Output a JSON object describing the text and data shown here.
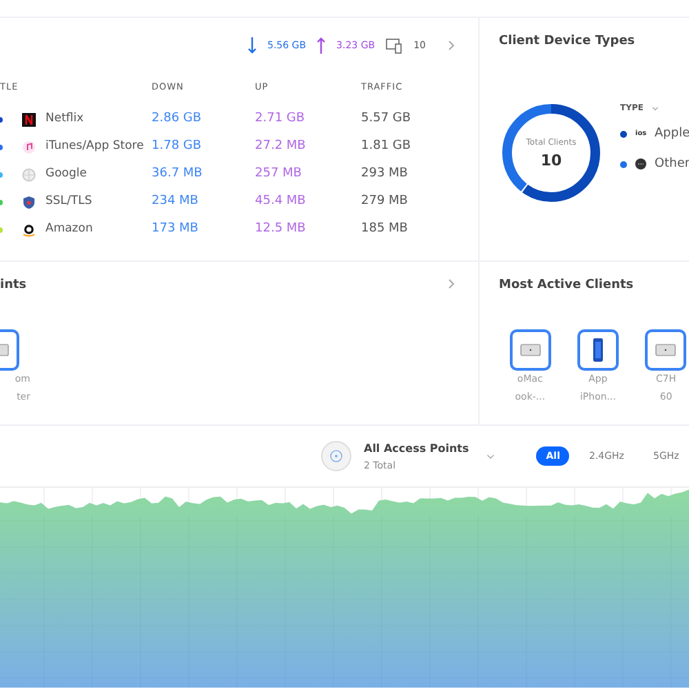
{
  "traffic": {
    "summary": {
      "down": "5.56 GB",
      "up": "3.23 GB",
      "clients": "10"
    },
    "columns": [
      "TLE",
      "DOWN",
      "UP",
      "TRAFFIC"
    ],
    "rows": [
      {
        "color": "#1846c8",
        "kind": "netflix",
        "name": "Netflix",
        "down": "2.86 GB",
        "up": "2.71 GB",
        "traffic": "5.57 GB"
      },
      {
        "color": "#2d6ff2",
        "kind": "itunes",
        "name": "iTunes/App Store",
        "down": "1.78 GB",
        "up": "27.2 MB",
        "traffic": "1.81 GB"
      },
      {
        "color": "#3cb7f2",
        "kind": "globe",
        "name": "Google",
        "down": "36.7 MB",
        "up": "257 MB",
        "traffic": "293 MB"
      },
      {
        "color": "#3fcf58",
        "kind": "shield",
        "name": "SSL/TLS",
        "down": "234 MB",
        "up": "45.4 MB",
        "traffic": "279 MB"
      },
      {
        "color": "#b8e23a",
        "kind": "amazon",
        "name": "Amazon",
        "down": "173 MB",
        "up": "12.5 MB",
        "traffic": "185 MB"
      }
    ]
  },
  "device_types": {
    "title": "Client Device Types",
    "center_label": "Total Clients",
    "center_value": "10",
    "legend_title": "TYPE",
    "legend": [
      {
        "badge": "ios",
        "label": "Apple",
        "color": "#0b48b8"
      },
      {
        "label": "Other",
        "color": "#1f6fe6"
      }
    ]
  },
  "access_points": {
    "title": "ints",
    "devices": [
      {
        "kind": "laptop",
        "line1": "om",
        "line2": "ter"
      }
    ]
  },
  "active_clients": {
    "title": "Most Active Clients",
    "clients": [
      {
        "kind": "laptop",
        "line1": "oMac",
        "line2": "ook-..."
      },
      {
        "kind": "phone",
        "line1": "App",
        "line2": "iPhon..."
      },
      {
        "kind": "laptop",
        "line1": "C7H",
        "line2": "60"
      }
    ]
  },
  "chart_header": {
    "ap_name": "All Access Points",
    "ap_count": "2 Total",
    "bands": [
      {
        "label": "All",
        "selected": true
      },
      {
        "label": "2.4GHz",
        "selected": false
      },
      {
        "label": "5GHz",
        "selected": false
      }
    ]
  }
}
